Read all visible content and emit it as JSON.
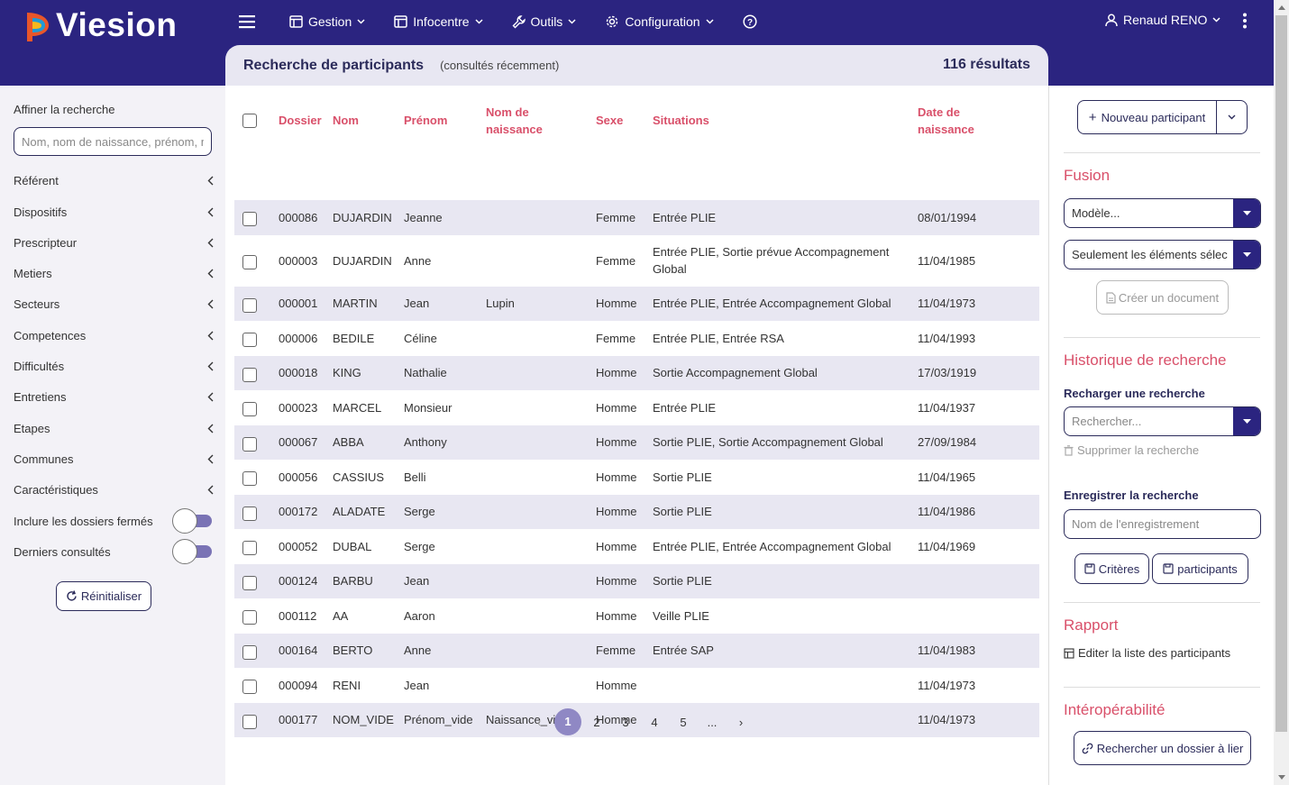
{
  "app": {
    "name": "Viesion"
  },
  "nav": {
    "gestion": "Gestion",
    "infocentre": "Infocentre",
    "outils": "Outils",
    "configuration": "Configuration",
    "user": "Renaud RENO"
  },
  "header": {
    "title": "Recherche de participants",
    "subtitle": "(consultés récemment)",
    "results": "116 résultats"
  },
  "sidebar": {
    "label": "Affiner la recherche",
    "search_placeholder": "Nom, nom de naissance, prénom, n",
    "filters": [
      "Référent",
      "Dispositifs",
      "Prescripteur",
      "Metiers",
      "Secteurs",
      "Competences",
      "Difficultés",
      "Entretiens",
      "Etapes",
      "Communes",
      "Caractéristiques"
    ],
    "toggles": [
      "Inclure les dossiers fermés",
      "Derniers consultés"
    ],
    "reset": "Réinitialiser"
  },
  "table": {
    "headers": {
      "dossier": "Dossier",
      "nom": "Nom",
      "prenom": "Prénom",
      "nom_naissance": "Nom de naissance",
      "sexe": "Sexe",
      "situations": "Situations",
      "date_naissance": "Date de naissance"
    },
    "rows": [
      [
        "000086",
        "DUJARDIN",
        "Jeanne",
        "",
        "Femme",
        "Entrée PLIE",
        "08/01/1994"
      ],
      [
        "000003",
        "DUJARDIN",
        "Anne",
        "",
        "Femme",
        "Entrée PLIE, Sortie prévue Accompagnement Global",
        "11/04/1985"
      ],
      [
        "000001",
        "MARTIN",
        "Jean",
        "Lupin",
        "Homme",
        "Entrée PLIE, Entrée Accompagnement Global",
        "11/04/1973"
      ],
      [
        "000006",
        "BEDILE",
        "Céline",
        "",
        "Femme",
        "Entrée PLIE, Entrée RSA",
        "11/04/1993"
      ],
      [
        "000018",
        "KING",
        "Nathalie",
        "",
        "Homme",
        "Sortie Accompagnement Global",
        "17/03/1919"
      ],
      [
        "000023",
        "MARCEL",
        "Monsieur",
        "",
        "Homme",
        "Entrée PLIE",
        "11/04/1937"
      ],
      [
        "000067",
        "ABBA",
        "Anthony",
        "",
        "Homme",
        "Sortie PLIE, Sortie Accompagnement Global",
        "27/09/1984"
      ],
      [
        "000056",
        "CASSIUS",
        "Belli",
        "",
        "Homme",
        "Sortie PLIE",
        "11/04/1965"
      ],
      [
        "000172",
        "ALADATE",
        "Serge",
        "",
        "Homme",
        "Sortie PLIE",
        "11/04/1986"
      ],
      [
        "000052",
        "DUBAL",
        "Serge",
        "",
        "Homme",
        "Entrée PLIE, Entrée Accompagnement Global",
        "11/04/1969"
      ],
      [
        "000124",
        "BARBU",
        "Jean",
        "",
        "Homme",
        "Sortie PLIE",
        ""
      ],
      [
        "000112",
        "AA",
        "Aaron",
        "",
        "Homme",
        "Veille PLIE",
        ""
      ],
      [
        "000164",
        "BERTO",
        "Anne",
        "",
        "Femme",
        "Entrée SAP",
        "11/04/1983"
      ],
      [
        "000094",
        "RENI",
        "Jean",
        "",
        "Homme",
        "",
        "11/04/1973"
      ],
      [
        "000177",
        "NOM_VIDE",
        "Prénom_vide",
        "Naissance_vide",
        "Homme",
        "",
        "11/04/1973"
      ]
    ]
  },
  "pagination": {
    "pages": [
      "1",
      "2",
      "3",
      "4",
      "5",
      "..."
    ],
    "active": "1"
  },
  "right": {
    "new_participant": "Nouveau participant",
    "fusion_title": "Fusion",
    "modele": "Modèle...",
    "selection": "Seulement les éléments sélec",
    "create_doc": "Créer un document",
    "history_title": "Historique de recherche",
    "reload_label": "Recharger une recherche",
    "search_placeholder": "Rechercher...",
    "delete_search": "Supprimer la recherche",
    "save_label": "Enregistrer la recherche",
    "save_placeholder": "Nom de l'enregistrement",
    "criteres": "Critères",
    "participants": "participants",
    "rapport_title": "Rapport",
    "edit_list": "Editer la liste des participants",
    "interop_title": "Intéropérabilité",
    "link_folder": "Rechercher un dossier à lier"
  },
  "colors": {
    "brand": "#2b2480",
    "accent": "#d9506a",
    "row_alt": "#e8e7f2",
    "active_page": "#8f88c4"
  }
}
